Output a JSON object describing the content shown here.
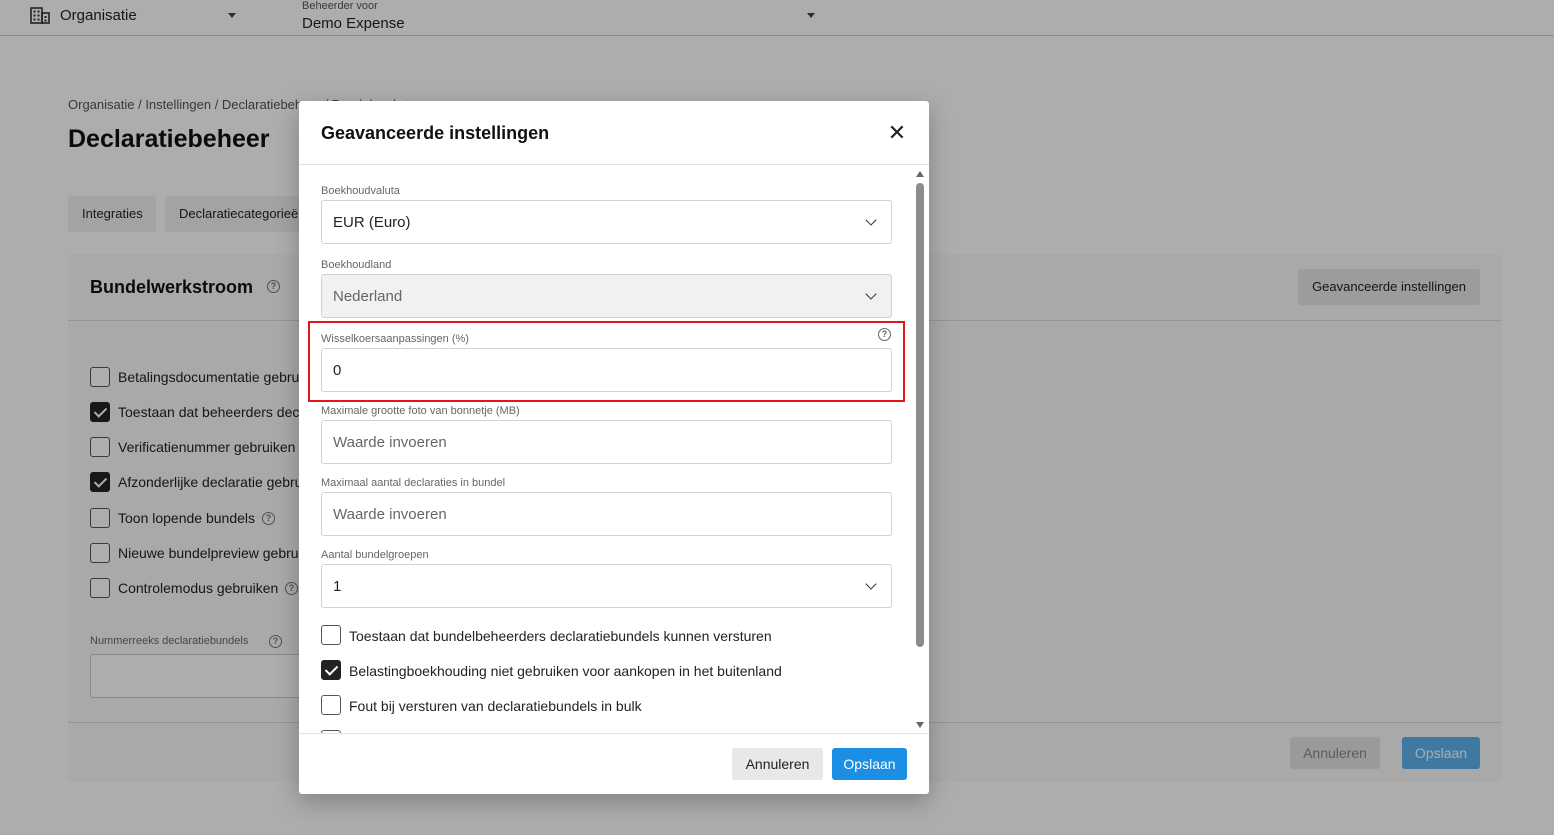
{
  "topbar": {
    "org_label": "Organisatie",
    "admin_label": "Beheerder voor",
    "admin_value": "Demo Expense"
  },
  "page": {
    "breadcrumb": "Organisatie / Instellingen / Declaratiebeheer / Bundelwerkstroom",
    "title": "Declaratiebeheer",
    "tabs": [
      "Integraties",
      "Declaratiecategorieën"
    ]
  },
  "card": {
    "title": "Bundelwerkstroom",
    "advanced_button": "Geavanceerde instellingen",
    "options": [
      {
        "label": "Betalingsdocumentatie gebruiken",
        "checked": false
      },
      {
        "label": "Toestaan dat beheerders declaraties",
        "checked": true
      },
      {
        "label": "Verificatienummer gebruiken",
        "checked": false
      },
      {
        "label": "Afzonderlijke declaratie gebruiken",
        "checked": true
      },
      {
        "label": "Toon lopende bundels",
        "checked": false
      },
      {
        "label": "Nieuwe bundelpreview gebruiken",
        "checked": false
      },
      {
        "label": "Controlemodus gebruiken",
        "checked": false
      }
    ],
    "number_range_label": "Nummerreeks declaratiebundels",
    "cancel": "Annuleren",
    "save": "Opslaan"
  },
  "modal": {
    "title": "Geavanceerde instellingen",
    "fields": {
      "currency": {
        "label": "Boekhoudvaluta",
        "value": "EUR (Euro)"
      },
      "country": {
        "label": "Boekhoudland",
        "value": "Nederland"
      },
      "exchange": {
        "label": "Wisselkoersaanpassingen (%)",
        "value": "0"
      },
      "photo_size": {
        "label": "Maximale grootte foto van bonnetje (MB)",
        "placeholder": "Waarde invoeren"
      },
      "max_claims": {
        "label": "Maximaal aantal declaraties in bundel",
        "placeholder": "Waarde invoeren"
      },
      "groups": {
        "label": "Aantal bundelgroepen",
        "value": "1"
      }
    },
    "checkboxes": [
      {
        "label": "Toestaan dat bundelbeheerders declaratiebundels kunnen versturen",
        "checked": false
      },
      {
        "label": "Belastingboekhouding niet gebruiken voor aankopen in het buitenland",
        "checked": true
      },
      {
        "label": "Fout bij versturen van declaratiebundels in bulk",
        "checked": false
      }
    ],
    "cancel": "Annuleren",
    "save": "Opslaan"
  }
}
